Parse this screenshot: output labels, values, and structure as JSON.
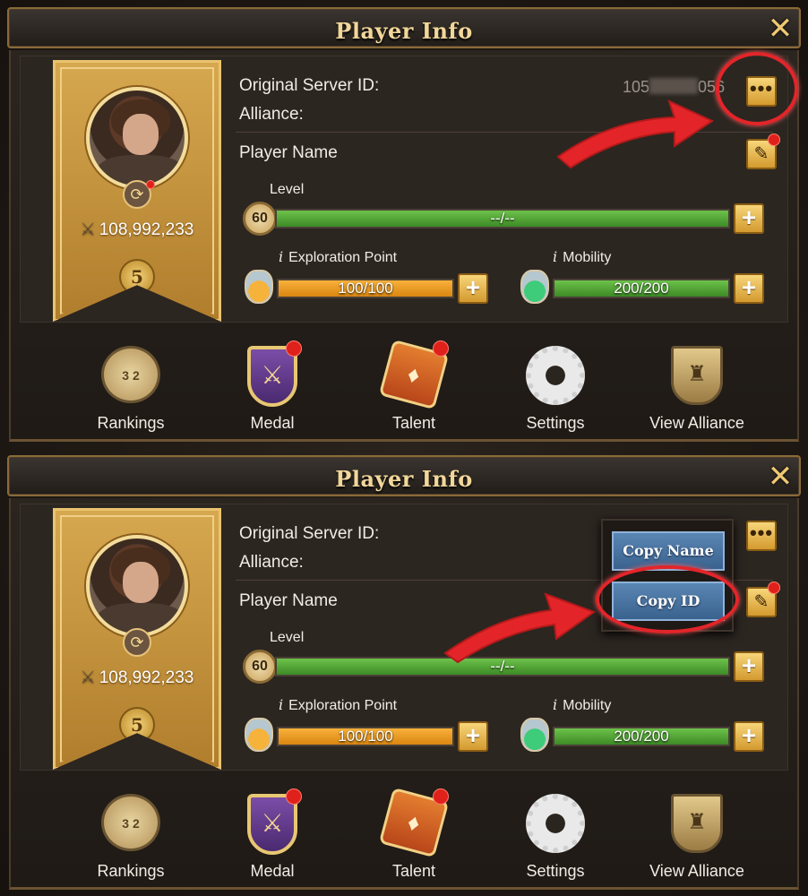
{
  "panels": [
    {
      "title": "Player Info",
      "server_label": "Original Server ID:",
      "server_prefix": "105",
      "server_suffix": "056",
      "alliance_label": "Alliance:",
      "player_name_label": "Player Name",
      "power": "108,992,233",
      "rank_number": "5",
      "level_label": "Level",
      "level_value": "60",
      "level_bar_text": "--/--",
      "exploration_label": "Exploration Point",
      "exploration_text": "100/100",
      "exploration_fraction": 1.0,
      "mobility_label": "Mobility",
      "mobility_text": "200/200",
      "mobility_fraction": 1.0,
      "level_fraction": 1.0,
      "toolbar": [
        "Rankings",
        "Medal",
        "Talent",
        "Settings",
        "View Alliance"
      ]
    },
    {
      "title": "Player Info",
      "server_label": "Original Server ID:",
      "alliance_label": "Alliance:",
      "player_name_label": "Player Name",
      "power": "108,992,233",
      "rank_number": "5",
      "level_label": "Level",
      "level_value": "60",
      "level_bar_text": "--/--",
      "exploration_label": "Exploration Point",
      "exploration_text": "100/100",
      "exploration_fraction": 1.0,
      "mobility_label": "Mobility",
      "mobility_text": "200/200",
      "mobility_fraction": 1.0,
      "level_fraction": 1.0,
      "popup": {
        "copy_name": "Copy Name",
        "copy_id": "Copy ID"
      },
      "toolbar": [
        "Rankings",
        "Medal",
        "Talent",
        "Settings",
        "View Alliance"
      ]
    }
  ],
  "icons": {
    "close": "close-icon",
    "more": "more-dots-icon",
    "edit": "pencil-icon",
    "swap": "swap-icon",
    "power": "crossed-swords-icon",
    "plus": "plus-icon"
  },
  "colors": {
    "accent_gold": "#d6a84f",
    "bar_green": "#4fa536",
    "bar_orange": "#f0a02a",
    "highlight_red": "#e3252a",
    "popup_blue": "#4a75a2"
  }
}
